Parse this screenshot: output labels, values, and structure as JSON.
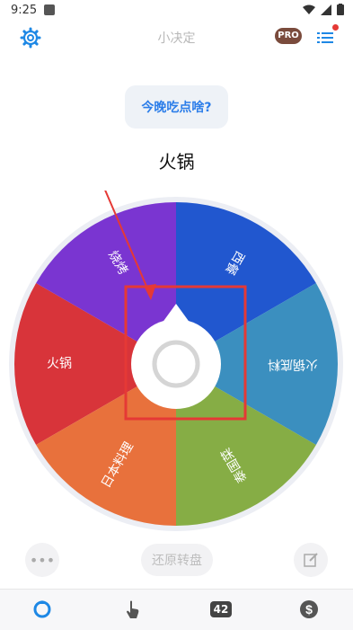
{
  "status": {
    "time": "9:25"
  },
  "appbar": {
    "title": "小决定",
    "pro_badge": "PRO"
  },
  "question": "今晚吃点啥?",
  "result": "火锅",
  "wheel": {
    "segments": [
      {
        "label": "火锅",
        "color": "#d8343a"
      },
      {
        "label": "烧烤",
        "color": "#7a35d1"
      },
      {
        "label": "西餐",
        "color": "#2157cf"
      },
      {
        "label": "火锅底料",
        "color": "#3b8fbf"
      },
      {
        "label": "泰国菜",
        "color": "#86ad45"
      },
      {
        "label": "日本料理",
        "color": "#e8713c"
      }
    ]
  },
  "actions": {
    "reset": "还原转盘",
    "more": "•••"
  },
  "tabbar": {
    "count_badge": "42"
  },
  "colors": {
    "accent": "#1e88e5",
    "pro": "#7a4b3c"
  }
}
